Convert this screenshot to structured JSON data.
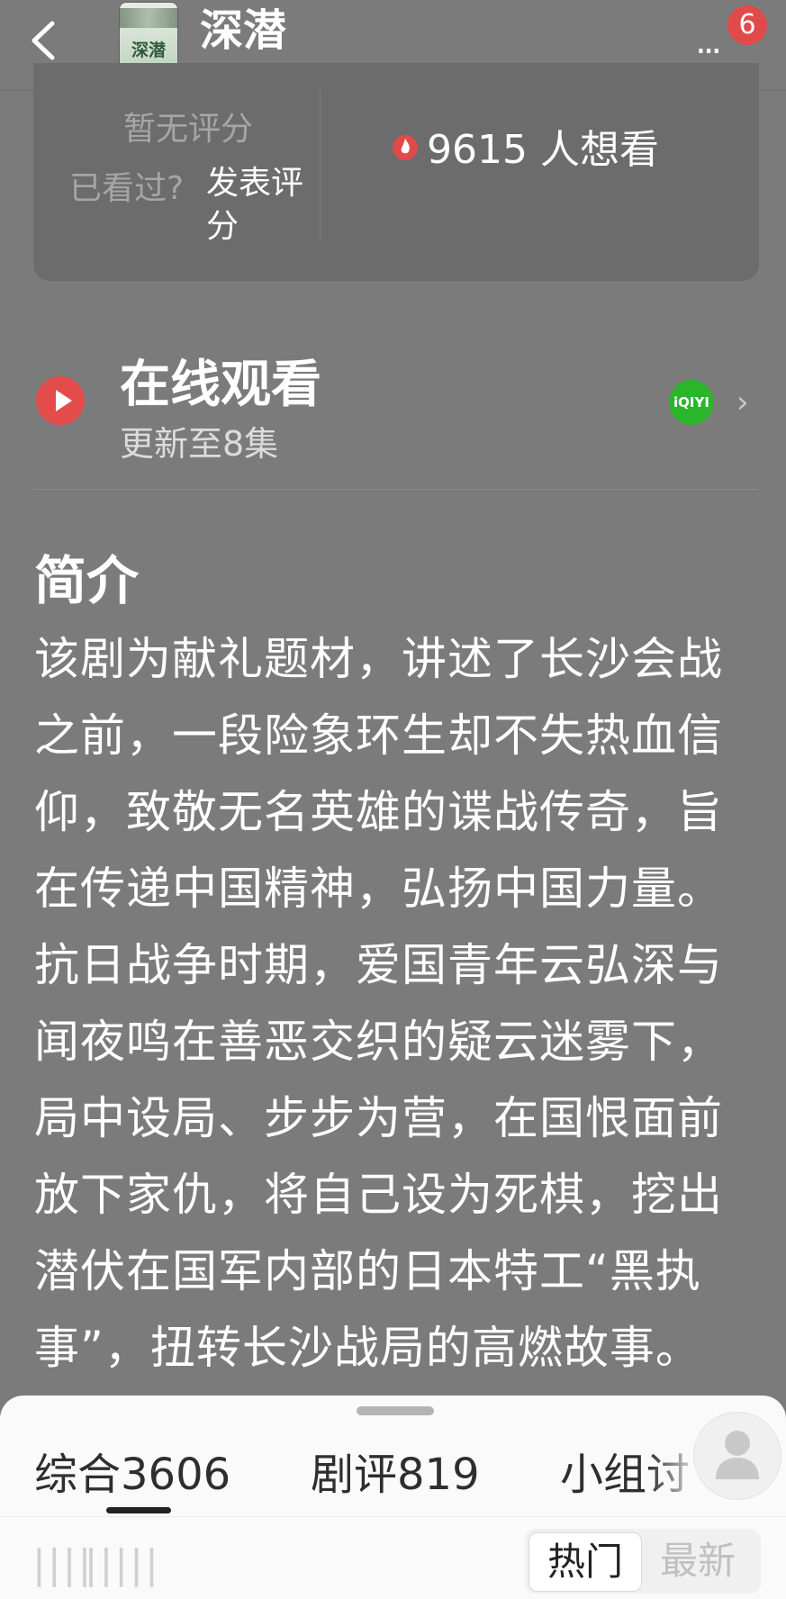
{
  "header": {
    "title": "深潜",
    "subtitle": "暂无评分",
    "poster_text": "深潜",
    "more_label": "...",
    "notification_count": "6"
  },
  "rating": {
    "no_rating": "暂无评分",
    "seen_prompt": "已看过?",
    "rate_action": "发表评分",
    "want_to_watch": "9615 人想看"
  },
  "online": {
    "title": "在线观看",
    "episodes": "更新至8集",
    "provider_logo_text": "iQIYI"
  },
  "synopsis": {
    "heading": "简介",
    "body": "该剧为献礼题材，讲述了长沙会战之前，一段险象环生却不失热血信仰，致敬无名英雄的谍战传奇，旨在传递中国精神，弘扬中国力量。抗日战争时期，爱国青年云弘深与闻夜鸣在善恶交织的疑云迷雾下，局中设局、步步为营，在国恨面前放下家仇，将自己设为死棋，挖出潜伏在国军内部的日本特工“黑执事”，扭转长沙战局的高燃故事。"
  },
  "tabs": [
    {
      "label": "综合",
      "count": "3606"
    },
    {
      "label": "剧评",
      "count": "819"
    },
    {
      "label": "小组讨",
      "count": ""
    }
  ],
  "sort": {
    "hot": "热门",
    "latest": "最新"
  },
  "colors": {
    "accent_red": "#e44c4c",
    "iqiyi_green": "#2bb52b",
    "overlay_gray": "#7b7b7b"
  }
}
